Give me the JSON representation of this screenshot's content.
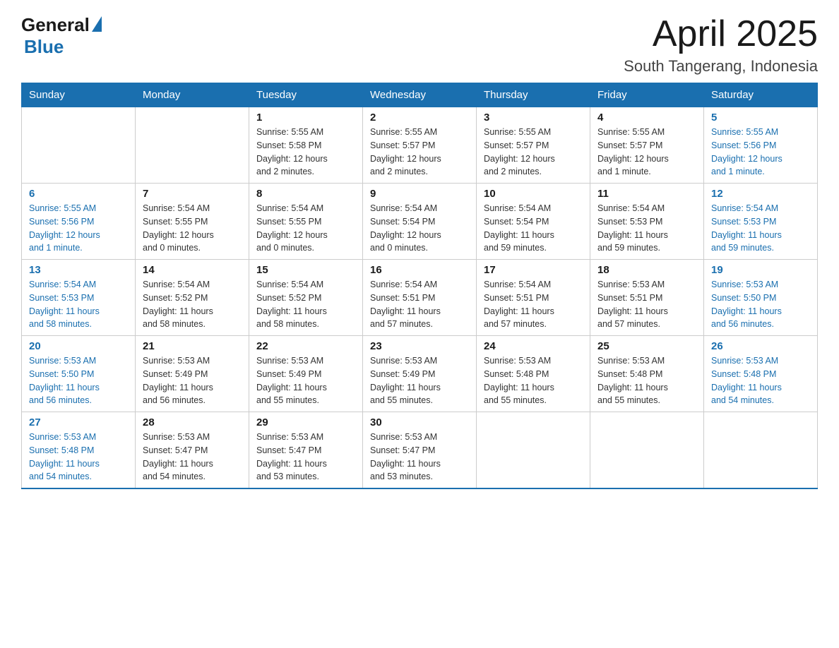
{
  "header": {
    "logo_general": "General",
    "logo_blue": "Blue",
    "title": "April 2025",
    "subtitle": "South Tangerang, Indonesia"
  },
  "weekdays": [
    "Sunday",
    "Monday",
    "Tuesday",
    "Wednesday",
    "Thursday",
    "Friday",
    "Saturday"
  ],
  "weeks": [
    [
      {
        "day": "",
        "info": ""
      },
      {
        "day": "",
        "info": ""
      },
      {
        "day": "1",
        "info": "Sunrise: 5:55 AM\nSunset: 5:58 PM\nDaylight: 12 hours\nand 2 minutes."
      },
      {
        "day": "2",
        "info": "Sunrise: 5:55 AM\nSunset: 5:57 PM\nDaylight: 12 hours\nand 2 minutes."
      },
      {
        "day": "3",
        "info": "Sunrise: 5:55 AM\nSunset: 5:57 PM\nDaylight: 12 hours\nand 2 minutes."
      },
      {
        "day": "4",
        "info": "Sunrise: 5:55 AM\nSunset: 5:57 PM\nDaylight: 12 hours\nand 1 minute."
      },
      {
        "day": "5",
        "info": "Sunrise: 5:55 AM\nSunset: 5:56 PM\nDaylight: 12 hours\nand 1 minute."
      }
    ],
    [
      {
        "day": "6",
        "info": "Sunrise: 5:55 AM\nSunset: 5:56 PM\nDaylight: 12 hours\nand 1 minute."
      },
      {
        "day": "7",
        "info": "Sunrise: 5:54 AM\nSunset: 5:55 PM\nDaylight: 12 hours\nand 0 minutes."
      },
      {
        "day": "8",
        "info": "Sunrise: 5:54 AM\nSunset: 5:55 PM\nDaylight: 12 hours\nand 0 minutes."
      },
      {
        "day": "9",
        "info": "Sunrise: 5:54 AM\nSunset: 5:54 PM\nDaylight: 12 hours\nand 0 minutes."
      },
      {
        "day": "10",
        "info": "Sunrise: 5:54 AM\nSunset: 5:54 PM\nDaylight: 11 hours\nand 59 minutes."
      },
      {
        "day": "11",
        "info": "Sunrise: 5:54 AM\nSunset: 5:53 PM\nDaylight: 11 hours\nand 59 minutes."
      },
      {
        "day": "12",
        "info": "Sunrise: 5:54 AM\nSunset: 5:53 PM\nDaylight: 11 hours\nand 59 minutes."
      }
    ],
    [
      {
        "day": "13",
        "info": "Sunrise: 5:54 AM\nSunset: 5:53 PM\nDaylight: 11 hours\nand 58 minutes."
      },
      {
        "day": "14",
        "info": "Sunrise: 5:54 AM\nSunset: 5:52 PM\nDaylight: 11 hours\nand 58 minutes."
      },
      {
        "day": "15",
        "info": "Sunrise: 5:54 AM\nSunset: 5:52 PM\nDaylight: 11 hours\nand 58 minutes."
      },
      {
        "day": "16",
        "info": "Sunrise: 5:54 AM\nSunset: 5:51 PM\nDaylight: 11 hours\nand 57 minutes."
      },
      {
        "day": "17",
        "info": "Sunrise: 5:54 AM\nSunset: 5:51 PM\nDaylight: 11 hours\nand 57 minutes."
      },
      {
        "day": "18",
        "info": "Sunrise: 5:53 AM\nSunset: 5:51 PM\nDaylight: 11 hours\nand 57 minutes."
      },
      {
        "day": "19",
        "info": "Sunrise: 5:53 AM\nSunset: 5:50 PM\nDaylight: 11 hours\nand 56 minutes."
      }
    ],
    [
      {
        "day": "20",
        "info": "Sunrise: 5:53 AM\nSunset: 5:50 PM\nDaylight: 11 hours\nand 56 minutes."
      },
      {
        "day": "21",
        "info": "Sunrise: 5:53 AM\nSunset: 5:49 PM\nDaylight: 11 hours\nand 56 minutes."
      },
      {
        "day": "22",
        "info": "Sunrise: 5:53 AM\nSunset: 5:49 PM\nDaylight: 11 hours\nand 55 minutes."
      },
      {
        "day": "23",
        "info": "Sunrise: 5:53 AM\nSunset: 5:49 PM\nDaylight: 11 hours\nand 55 minutes."
      },
      {
        "day": "24",
        "info": "Sunrise: 5:53 AM\nSunset: 5:48 PM\nDaylight: 11 hours\nand 55 minutes."
      },
      {
        "day": "25",
        "info": "Sunrise: 5:53 AM\nSunset: 5:48 PM\nDaylight: 11 hours\nand 55 minutes."
      },
      {
        "day": "26",
        "info": "Sunrise: 5:53 AM\nSunset: 5:48 PM\nDaylight: 11 hours\nand 54 minutes."
      }
    ],
    [
      {
        "day": "27",
        "info": "Sunrise: 5:53 AM\nSunset: 5:48 PM\nDaylight: 11 hours\nand 54 minutes."
      },
      {
        "day": "28",
        "info": "Sunrise: 5:53 AM\nSunset: 5:47 PM\nDaylight: 11 hours\nand 54 minutes."
      },
      {
        "day": "29",
        "info": "Sunrise: 5:53 AM\nSunset: 5:47 PM\nDaylight: 11 hours\nand 53 minutes."
      },
      {
        "day": "30",
        "info": "Sunrise: 5:53 AM\nSunset: 5:47 PM\nDaylight: 11 hours\nand 53 minutes."
      },
      {
        "day": "",
        "info": ""
      },
      {
        "day": "",
        "info": ""
      },
      {
        "day": "",
        "info": ""
      }
    ]
  ]
}
